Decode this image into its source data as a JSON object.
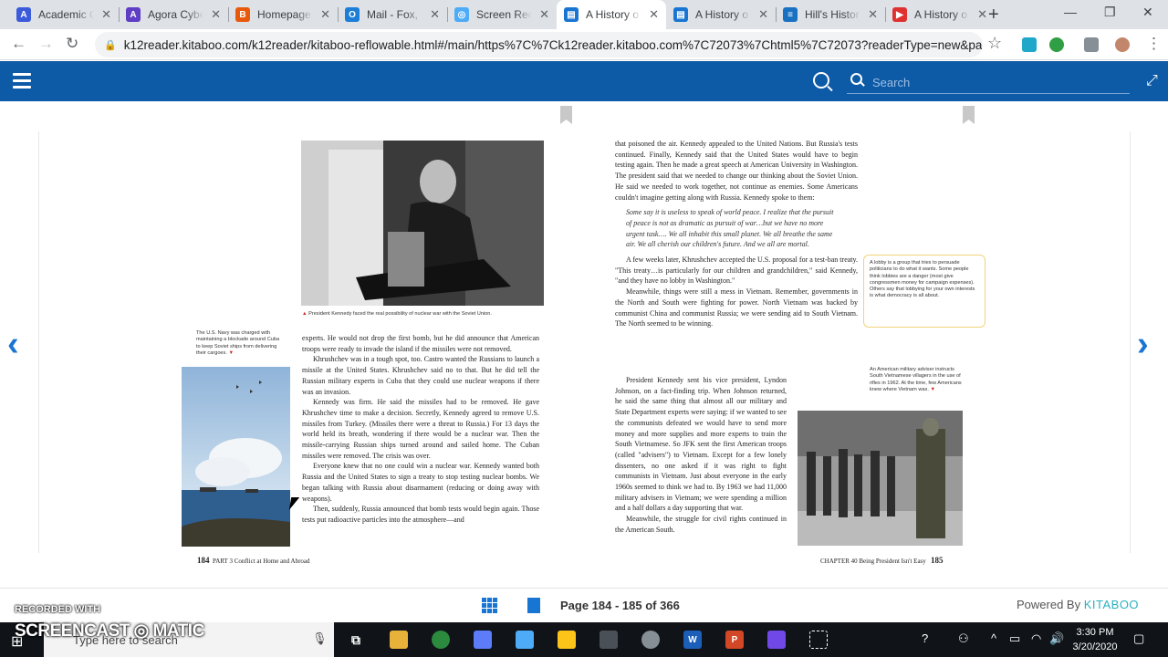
{
  "browser": {
    "tabs": [
      {
        "title": "Academic C",
        "color": "#3b5bdb",
        "glyph": "A"
      },
      {
        "title": "Agora Cybe",
        "color": "#5f3dc4",
        "glyph": "A"
      },
      {
        "title": "Homepage",
        "color": "#e8590c",
        "glyph": "B"
      },
      {
        "title": "Mail - Fox,",
        "color": "#1c7ed6",
        "glyph": "O"
      },
      {
        "title": "Screen Rec",
        "color": "#4dabf7",
        "glyph": "◎"
      },
      {
        "title": "A History o",
        "color": "#1875d1",
        "glyph": "▤"
      },
      {
        "title": "A History o",
        "color": "#1875d1",
        "glyph": "▤"
      },
      {
        "title": "Hill's Histor",
        "color": "#1971c2",
        "glyph": "≡"
      },
      {
        "title": "A History o",
        "color": "#e03131",
        "glyph": "▶"
      }
    ],
    "active_tab": 5,
    "new_tab_icon": "plus-icon",
    "url": "k12reader.kitaboo.com/k12reader/kitaboo-reflowable.html#/main/https%7C%7Ck12reader.kitaboo.com%7C72073%7Chtml5%7C72073?readerType=new&pag..."
  },
  "reader": {
    "search_placeholder": "Search",
    "page_info": "Page 184 - 185 of 366",
    "powered_by": "Powered By",
    "brand": "KITABOO"
  },
  "book": {
    "left": {
      "photo_caption": "President Kennedy faced the real possibility of nuclear war with the Soviet Union.",
      "navy_caption": "The U.S. Navy was charged with maintaining a blockade around Cuba to keep Soviet ships from delivering their cargoes.",
      "paragraphs": [
        "experts. He would not drop the first bomb, but he did announce that American troops were ready to invade the island if the missiles were not removed.",
        "Khrushchev was in a tough spot, too. Castro wanted the Russians to launch a missile at the United States. Khrushchev said no to that. But he did tell the Russian military experts in Cuba that they could use nuclear weapons if there was an invasion.",
        "Kennedy was firm. He said the missiles had to be removed. He gave Khrushchev time to make a decision. Secretly, Kennedy agreed to remove U.S. missiles from Turkey. (Missiles there were a threat to Russia.) For 13 days the world held its breath, wondering if there would be a nuclear war. Then the missile-carrying Russian ships turned around and sailed home. The Cuban missiles were removed. The crisis was over.",
        "Everyone knew that no one could win a nuclear war. Kennedy wanted both Russia and the United States to sign a treaty to stop testing nuclear bombs. We began talking with Russia about disarmament (reducing or doing away with weapons).",
        "Then, suddenly, Russia announced that bomb tests would begin again. Those tests put radioactive particles into the atmosphere—and"
      ],
      "folio_number": "184",
      "folio_text": "PART 3  Conflict at Home and Abroad"
    },
    "right": {
      "para_intro": "that poisoned the air. Kennedy appealed to the United Nations. But Russia's tests continued. Finally, Kennedy said that the United States would have to begin testing again. Then he made a great speech at American University in Washington. The president said that we needed to change our thinking about the Soviet Union. He said we needed to work together, not continue as enemies. Some Americans couldn't imagine getting along with Russia. Kennedy spoke to them:",
      "quote": "Some say it is useless to speak of world peace. I realize that the pursuit of peace is not as dramatic as pursuit of war…but we have no more urgent task…. We all inhabit this small planet. We all breathe the same air. We all cherish our children's future. And we all are mortal.",
      "paragraphs": [
        "A few weeks later, Khrushchev accepted the U.S. proposal for a test-ban treaty. \"This treaty…is particularly for our children and grandchildren,\" said Kennedy, \"and they have no lobby in Washington.\"",
        "Meanwhile, things were still a mess in Vietnam. Remember, governments in the North and South were fighting for power. North Vietnam was backed by communist China and communist Russia; we were sending aid to South Vietnam. The North seemed to be winning.",
        "President Kennedy sent his vice president, Lyndon Johnson, on a fact-finding trip. When Johnson returned, he said the same thing that almost all our military and State Department experts were saying: if we wanted to see the communists defeated we would have to send more money and more supplies and more experts to train the South Vietnamese. So JFK sent the first American troops (called \"advisers\") to Vietnam. Except for a few lonely dissenters, no one asked if it was right to fight communists in Vietnam. Just about everyone in the early 1960s seemed to think we had to. By 1963 we had 11,000 military advisers in Vietnam; we were spending a million and a half dollars a day supporting that war.",
        "Meanwhile, the struggle for civil rights continued in the American South."
      ],
      "lobby_note": "A lobby is a group that tries to persuade politicians to do what it wants. Some people think lobbies are a danger (most give congressmen money for campaign expenses). Others say that lobbying for your own interests is what democracy is all about.",
      "adviser_caption": "An American military adviser instructs South Vietnamese villagers in the use of rifles in 1962. At the time, few Americans knew where Vietnam was.",
      "folio_text": "CHAPTER 40  Being President Isn't Easy",
      "folio_number": "185"
    }
  },
  "screencast": {
    "recorded": "RECORDED WITH",
    "brand": "SCREENCAST ◎ MATIC"
  },
  "taskbar": {
    "search_placeholder": "Type here to search",
    "time": "3:30 PM",
    "date": "3/20/2020"
  }
}
